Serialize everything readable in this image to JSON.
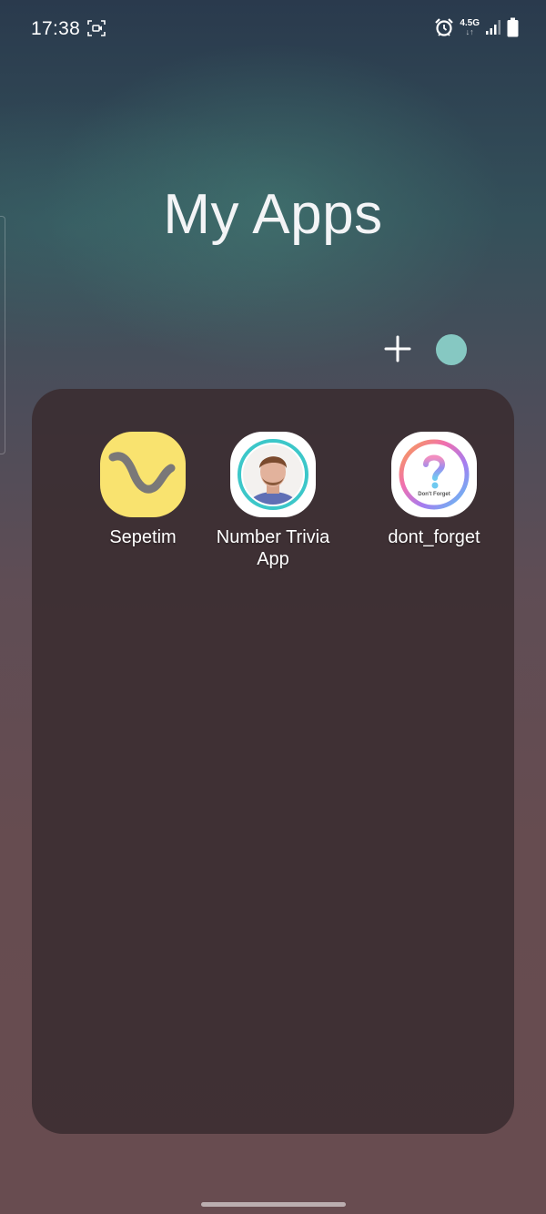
{
  "status_bar": {
    "time": "17:38",
    "network_type": "4.5G",
    "network_arrows": "↓↑",
    "icons": [
      "screen-record-icon",
      "alarm-icon",
      "signal-icon",
      "battery-icon"
    ]
  },
  "folder": {
    "title": "My Apps",
    "color": "#86c8c2",
    "apps": [
      {
        "label": "Sepetim",
        "icon": "sepetim-icon"
      },
      {
        "label": "Number Trivia\nApp",
        "icon": "number-trivia-icon"
      },
      {
        "label": "dont_forget",
        "icon": "dont-forget-icon",
        "icon_text": "Don't Forget"
      }
    ]
  }
}
